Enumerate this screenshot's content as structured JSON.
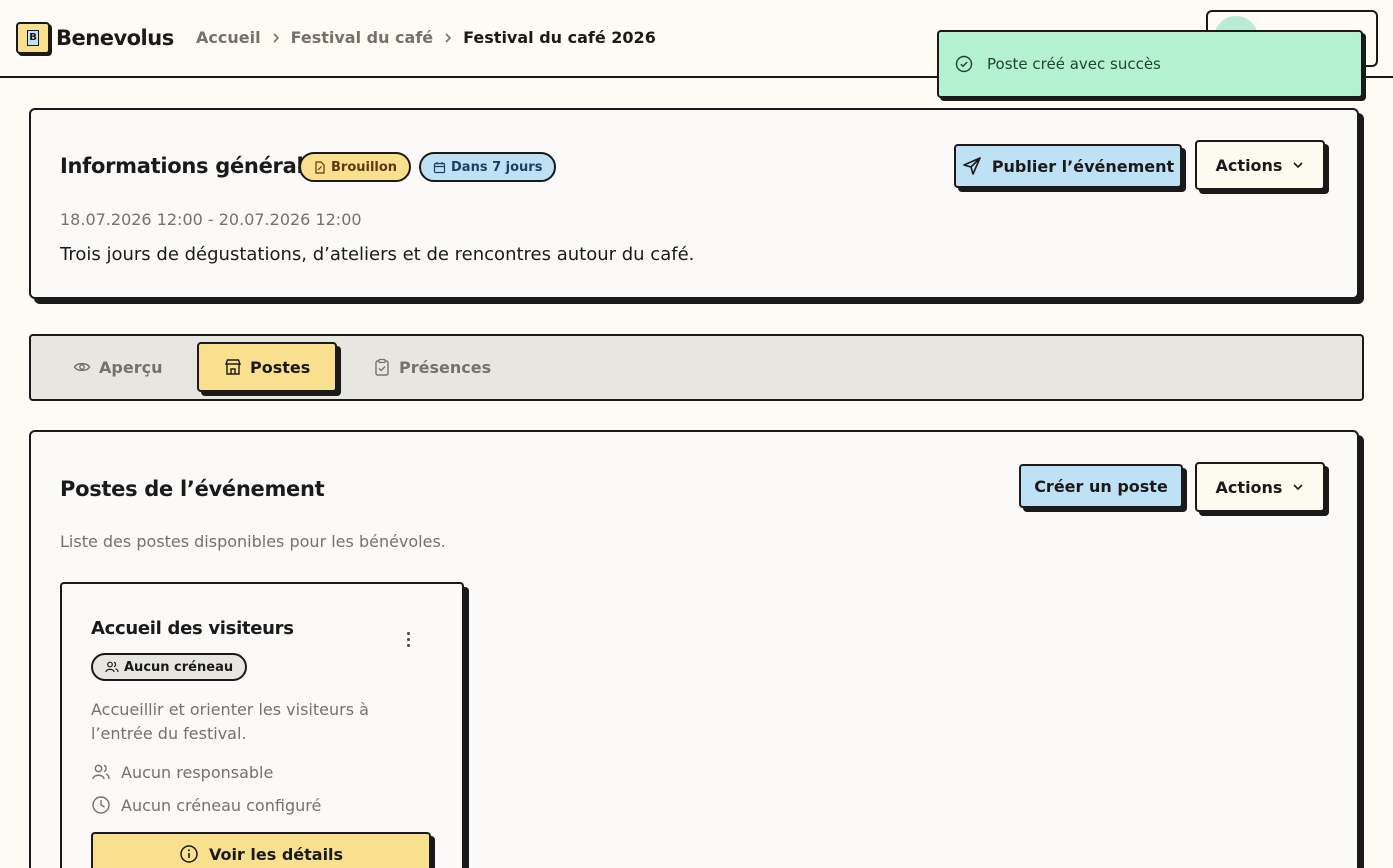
{
  "app": {
    "name": "Benevolus",
    "logo_letter": "B"
  },
  "breadcrumb": [
    {
      "label": "Accueil"
    },
    {
      "label": "Festival du café"
    },
    {
      "label": "Festival du café 2026"
    }
  ],
  "toast": {
    "message": "Poste créé avec succès"
  },
  "event": {
    "section_title": "Informations générales",
    "status_badge": "Brouillon",
    "date_badge": "Dans 7 jours",
    "dates": "18.07.2026 12:00 - 20.07.2026 12:00",
    "description": "Trois jours de dégustations, d’ateliers et de rencontres autour du café.",
    "publish_label": "Publier l’événement",
    "actions_label": "Actions"
  },
  "tabs": [
    {
      "label": "Aperçu",
      "icon": "eye-icon"
    },
    {
      "label": "Postes",
      "icon": "store-icon"
    },
    {
      "label": "Présences",
      "icon": "clipboard-check-icon"
    }
  ],
  "posts": {
    "title": "Postes de l’événement",
    "subtitle": "Liste des postes disponibles pour les bénévoles.",
    "create_label": "Créer un poste",
    "actions_label": "Actions",
    "items": [
      {
        "title": "Accueil des visiteurs",
        "slot_badge": "Aucun créneau",
        "description": "Accueillir et orienter les visiteurs à l’entrée du festival.",
        "manager": "Aucun responsable",
        "slots": "Aucun créneau configuré",
        "details_label": "Voir les détails"
      }
    ]
  },
  "colors": {
    "background": "#fdfbf3",
    "yellow": "#f8e08e",
    "blue": "#bfe1f5",
    "toast_green": "#b4f1d1",
    "muted_text": "#77716a"
  }
}
